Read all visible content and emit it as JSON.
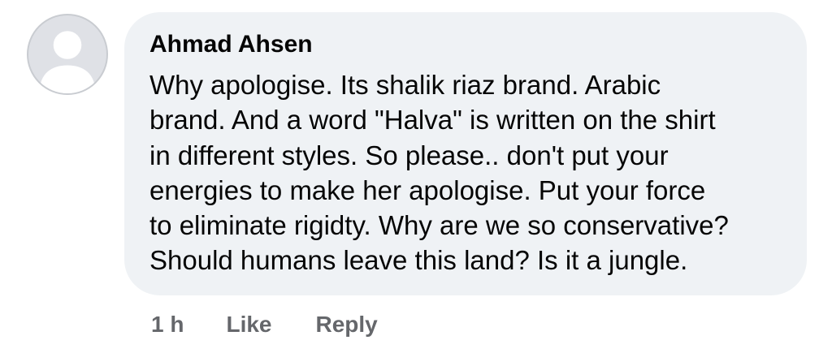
{
  "comment": {
    "author": "Ahmad Ahsen",
    "avatar_icon": "default-user-avatar-icon",
    "text_lines": [
      "Why apologise. Its shalik riaz brand. Arabic",
      "brand. And a word \"Halva\" is written on the shirt",
      "in different styles. So please.. don't put your",
      "energies to make her apologise. Put your force",
      "to eliminate rigidty. Why are we so conservative?",
      "Should humans leave this land? Is it a jungle."
    ],
    "timestamp": "1 h",
    "like_label": "Like",
    "reply_label": "Reply"
  },
  "colors": {
    "bubble_background": "#eff2f5",
    "text": "#050505",
    "secondary_text": "#65676b",
    "avatar_background": "#dfe1e6",
    "avatar_glyph": "#ffffff"
  }
}
